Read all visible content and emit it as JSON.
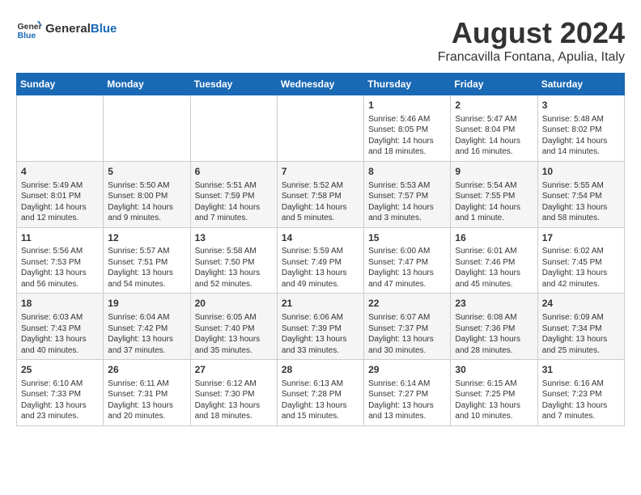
{
  "logo": {
    "general": "General",
    "blue": "Blue"
  },
  "title": "August 2024",
  "location": "Francavilla Fontana, Apulia, Italy",
  "headers": [
    "Sunday",
    "Monday",
    "Tuesday",
    "Wednesday",
    "Thursday",
    "Friday",
    "Saturday"
  ],
  "weeks": [
    [
      {
        "day": "",
        "detail": ""
      },
      {
        "day": "",
        "detail": ""
      },
      {
        "day": "",
        "detail": ""
      },
      {
        "day": "",
        "detail": ""
      },
      {
        "day": "1",
        "detail": "Sunrise: 5:46 AM\nSunset: 8:05 PM\nDaylight: 14 hours\nand 18 minutes."
      },
      {
        "day": "2",
        "detail": "Sunrise: 5:47 AM\nSunset: 8:04 PM\nDaylight: 14 hours\nand 16 minutes."
      },
      {
        "day": "3",
        "detail": "Sunrise: 5:48 AM\nSunset: 8:02 PM\nDaylight: 14 hours\nand 14 minutes."
      }
    ],
    [
      {
        "day": "4",
        "detail": "Sunrise: 5:49 AM\nSunset: 8:01 PM\nDaylight: 14 hours\nand 12 minutes."
      },
      {
        "day": "5",
        "detail": "Sunrise: 5:50 AM\nSunset: 8:00 PM\nDaylight: 14 hours\nand 9 minutes."
      },
      {
        "day": "6",
        "detail": "Sunrise: 5:51 AM\nSunset: 7:59 PM\nDaylight: 14 hours\nand 7 minutes."
      },
      {
        "day": "7",
        "detail": "Sunrise: 5:52 AM\nSunset: 7:58 PM\nDaylight: 14 hours\nand 5 minutes."
      },
      {
        "day": "8",
        "detail": "Sunrise: 5:53 AM\nSunset: 7:57 PM\nDaylight: 14 hours\nand 3 minutes."
      },
      {
        "day": "9",
        "detail": "Sunrise: 5:54 AM\nSunset: 7:55 PM\nDaylight: 14 hours\nand 1 minute."
      },
      {
        "day": "10",
        "detail": "Sunrise: 5:55 AM\nSunset: 7:54 PM\nDaylight: 13 hours\nand 58 minutes."
      }
    ],
    [
      {
        "day": "11",
        "detail": "Sunrise: 5:56 AM\nSunset: 7:53 PM\nDaylight: 13 hours\nand 56 minutes."
      },
      {
        "day": "12",
        "detail": "Sunrise: 5:57 AM\nSunset: 7:51 PM\nDaylight: 13 hours\nand 54 minutes."
      },
      {
        "day": "13",
        "detail": "Sunrise: 5:58 AM\nSunset: 7:50 PM\nDaylight: 13 hours\nand 52 minutes."
      },
      {
        "day": "14",
        "detail": "Sunrise: 5:59 AM\nSunset: 7:49 PM\nDaylight: 13 hours\nand 49 minutes."
      },
      {
        "day": "15",
        "detail": "Sunrise: 6:00 AM\nSunset: 7:47 PM\nDaylight: 13 hours\nand 47 minutes."
      },
      {
        "day": "16",
        "detail": "Sunrise: 6:01 AM\nSunset: 7:46 PM\nDaylight: 13 hours\nand 45 minutes."
      },
      {
        "day": "17",
        "detail": "Sunrise: 6:02 AM\nSunset: 7:45 PM\nDaylight: 13 hours\nand 42 minutes."
      }
    ],
    [
      {
        "day": "18",
        "detail": "Sunrise: 6:03 AM\nSunset: 7:43 PM\nDaylight: 13 hours\nand 40 minutes."
      },
      {
        "day": "19",
        "detail": "Sunrise: 6:04 AM\nSunset: 7:42 PM\nDaylight: 13 hours\nand 37 minutes."
      },
      {
        "day": "20",
        "detail": "Sunrise: 6:05 AM\nSunset: 7:40 PM\nDaylight: 13 hours\nand 35 minutes."
      },
      {
        "day": "21",
        "detail": "Sunrise: 6:06 AM\nSunset: 7:39 PM\nDaylight: 13 hours\nand 33 minutes."
      },
      {
        "day": "22",
        "detail": "Sunrise: 6:07 AM\nSunset: 7:37 PM\nDaylight: 13 hours\nand 30 minutes."
      },
      {
        "day": "23",
        "detail": "Sunrise: 6:08 AM\nSunset: 7:36 PM\nDaylight: 13 hours\nand 28 minutes."
      },
      {
        "day": "24",
        "detail": "Sunrise: 6:09 AM\nSunset: 7:34 PM\nDaylight: 13 hours\nand 25 minutes."
      }
    ],
    [
      {
        "day": "25",
        "detail": "Sunrise: 6:10 AM\nSunset: 7:33 PM\nDaylight: 13 hours\nand 23 minutes."
      },
      {
        "day": "26",
        "detail": "Sunrise: 6:11 AM\nSunset: 7:31 PM\nDaylight: 13 hours\nand 20 minutes."
      },
      {
        "day": "27",
        "detail": "Sunrise: 6:12 AM\nSunset: 7:30 PM\nDaylight: 13 hours\nand 18 minutes."
      },
      {
        "day": "28",
        "detail": "Sunrise: 6:13 AM\nSunset: 7:28 PM\nDaylight: 13 hours\nand 15 minutes."
      },
      {
        "day": "29",
        "detail": "Sunrise: 6:14 AM\nSunset: 7:27 PM\nDaylight: 13 hours\nand 13 minutes."
      },
      {
        "day": "30",
        "detail": "Sunrise: 6:15 AM\nSunset: 7:25 PM\nDaylight: 13 hours\nand 10 minutes."
      },
      {
        "day": "31",
        "detail": "Sunrise: 6:16 AM\nSunset: 7:23 PM\nDaylight: 13 hours\nand 7 minutes."
      }
    ]
  ]
}
